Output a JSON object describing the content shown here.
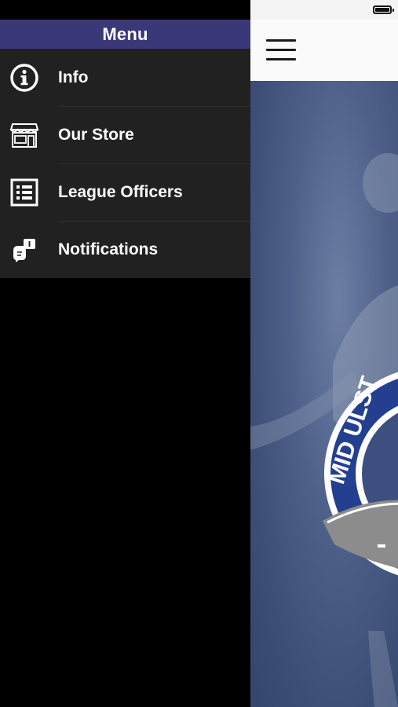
{
  "drawer": {
    "title": "Menu",
    "items": [
      {
        "label": "Info",
        "icon": "info-icon"
      },
      {
        "label": "Our Store",
        "icon": "store-icon"
      },
      {
        "label": "League Officers",
        "icon": "list-icon"
      },
      {
        "label": "Notifications",
        "icon": "notification-icon"
      }
    ]
  },
  "main": {
    "menu_icon": "hamburger-icon",
    "badge_text": "MID ULST"
  },
  "colors": {
    "header": "#3a3878",
    "drawer_bg": "#212121",
    "hero": "#4e6089",
    "badge_ring": "#243f8f"
  }
}
